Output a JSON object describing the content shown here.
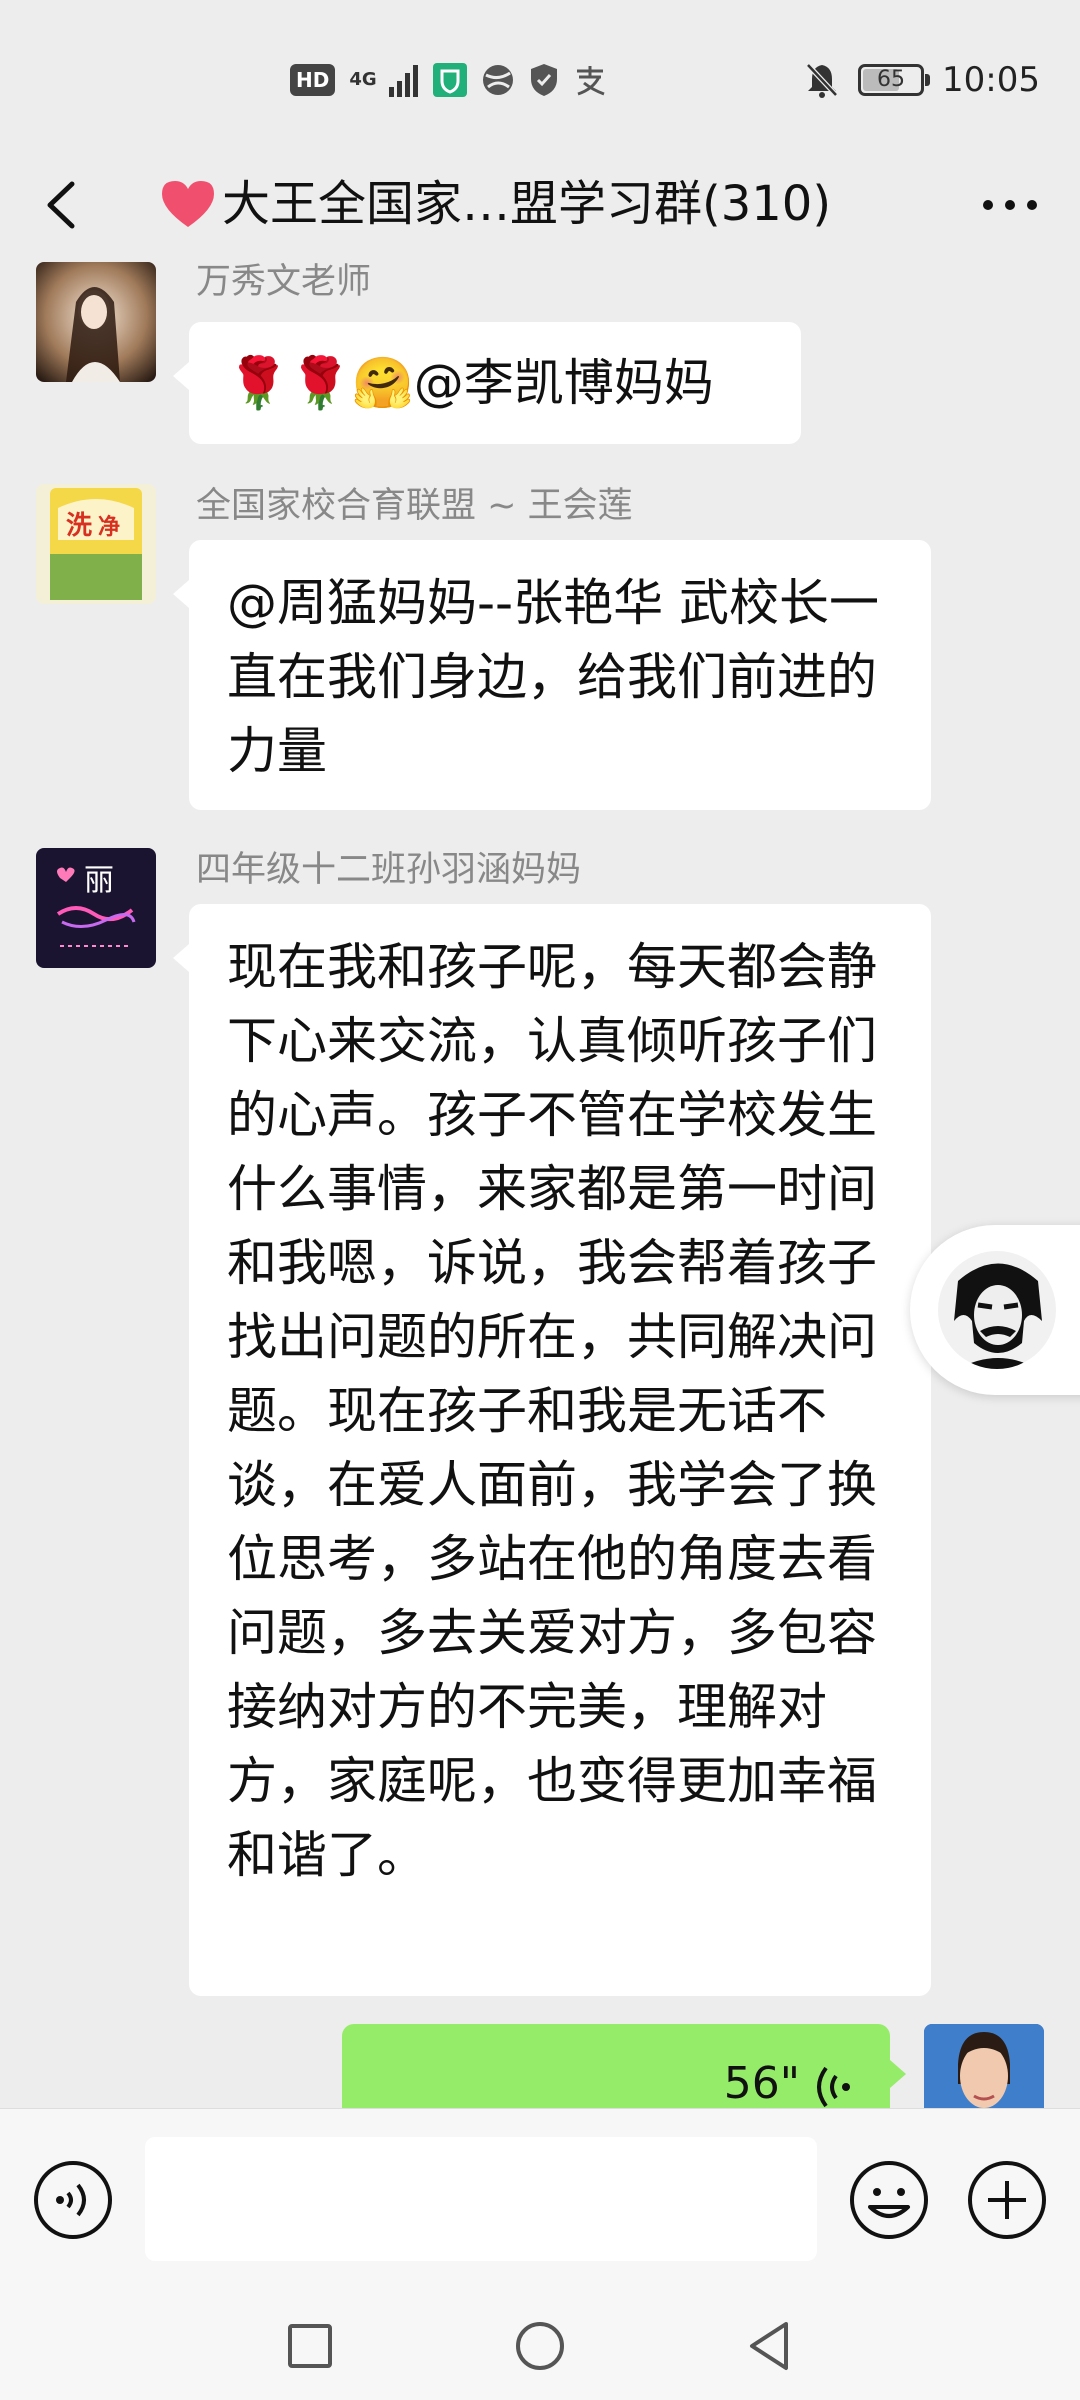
{
  "status_bar": {
    "hd": "HD",
    "network": "4G",
    "battery": "65",
    "battery_level": 0.65,
    "time": "10:05"
  },
  "header": {
    "title": "大王全国家…盟学习群(310)",
    "icons": [
      "back-arrow-icon",
      "heart-icon",
      "more-icon"
    ]
  },
  "messages": [
    {
      "sender": "万秀文老师",
      "text": "🌹🌹🤗@李凯博妈妈"
    },
    {
      "sender": "全国家校合育联盟 ~ 王会莲",
      "text": "@周猛妈妈--张艳华  武校长一直在我们身边，给我们前进的力量"
    },
    {
      "sender": "四年级十二班孙羽涵妈妈",
      "text": "现在我和孩子呢，每天都会静下心来交流，认真倾听孩子们的心声。孩子不管在学校发生什么事情，来家都是第一时间和我嗯，诉说，我会帮着孩子找出问题的所在，共同解决问题。现在孩子和我是无话不谈，在爱人面前，我学会了换位思考，多站在他的角度去看问题，多去关爱对方，多包容接纳对方的不完美，理解对方，家庭呢，也变得更加幸福和谐了。"
    }
  ],
  "own_voice": {
    "duration": "56\""
  },
  "avatar_badge_text": "丽",
  "input": {
    "placeholder": ""
  },
  "colors": {
    "background": "#ededed",
    "bubble": "#ffffff",
    "own_bubble": "#95ec69",
    "heart": "#f0506e"
  }
}
